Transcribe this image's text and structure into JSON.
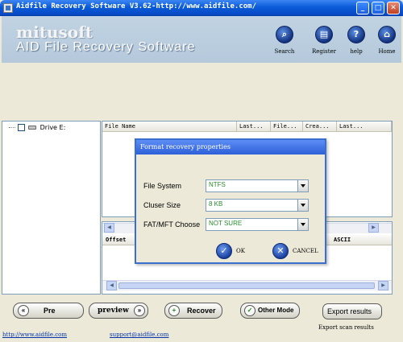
{
  "window": {
    "title": "Aidfile Recovery Software V3.62-http://www.aidfile.com/",
    "minimize": "_",
    "maximize": "□",
    "close": "✕"
  },
  "header": {
    "brand": "mitusoft",
    "product": "AID File Recovery Software"
  },
  "toolbar": [
    {
      "label": "Search",
      "icon": "search-icon"
    },
    {
      "label": "Register",
      "icon": "register-icon"
    },
    {
      "label": "help",
      "icon": "help-icon"
    },
    {
      "label": "Home",
      "icon": "home-icon"
    }
  ],
  "tree": {
    "items": [
      {
        "label": "Drive E:"
      }
    ]
  },
  "file_list": {
    "columns": [
      "File Name",
      "Last...",
      "File...",
      "Crea...",
      "Last..."
    ]
  },
  "hex_view": {
    "columns": [
      "Offset",
      "ASCII"
    ]
  },
  "dialog": {
    "title": "Format recovery properties",
    "fields": [
      {
        "label": "File System",
        "value": "NTFS"
      },
      {
        "label": "Cluser Size",
        "value": "8 KB"
      },
      {
        "label": "FAT/MFT Choose",
        "value": "NOT SURE"
      }
    ],
    "ok_label": "OK",
    "cancel_label": "CANCEL"
  },
  "buttons": {
    "pre": "Pre",
    "preview": "preview",
    "recover": "Recover",
    "other_mode": "Other Mode",
    "export": "Export results"
  },
  "export_caption": "Export scan results",
  "footer": {
    "website": "http://www.aidfile.com",
    "email": "support@aidfile.com"
  }
}
